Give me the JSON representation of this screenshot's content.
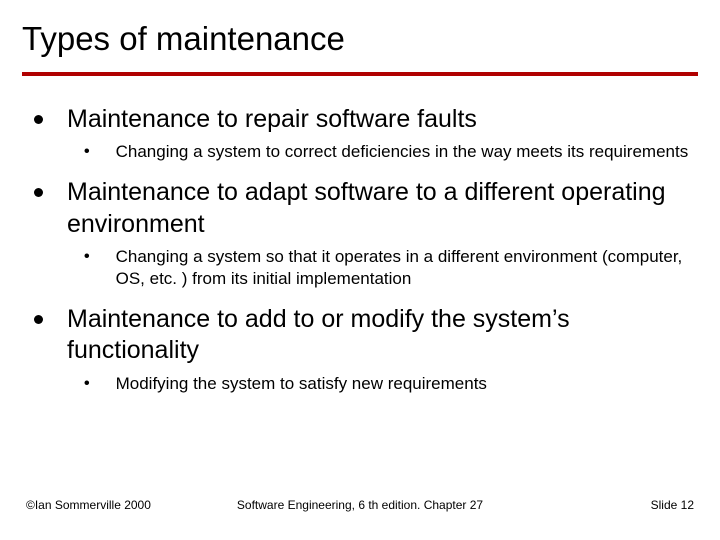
{
  "title": "Types of maintenance",
  "items": [
    {
      "text": "Maintenance to repair software faults",
      "subitems": [
        {
          "text": "Changing a system to correct deficiencies in the way meets its requirements"
        }
      ]
    },
    {
      "text": "Maintenance to adapt software to a different operating environment",
      "subitems": [
        {
          "text": "Changing a system so that it operates in a different environment (computer, OS, etc. ) from its initial implementation"
        }
      ]
    },
    {
      "text": "Maintenance to add to or modify the system’s functionality",
      "subitems": [
        {
          "text": "Modifying the system to satisfy new requirements"
        }
      ]
    }
  ],
  "footer": {
    "left": "©Ian Sommerville 2000",
    "center": "Software Engineering, 6 th edition. Chapter 27",
    "right": "Slide 12"
  }
}
